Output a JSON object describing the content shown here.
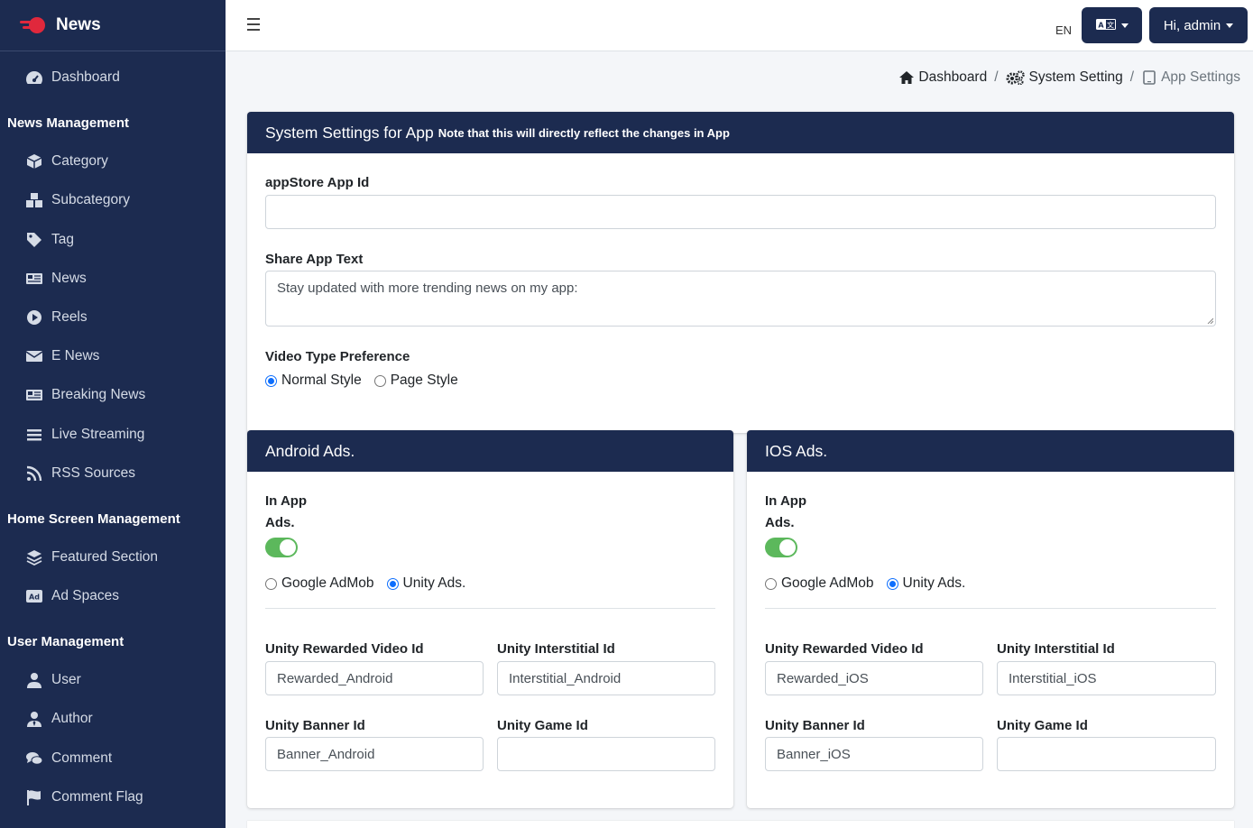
{
  "brand": {
    "name": "News"
  },
  "sidebar": {
    "dashboard": "Dashboard",
    "news_management_header": "News Management",
    "news_items": [
      "Category",
      "Subcategory",
      "Tag",
      "News",
      "Reels",
      "E News",
      "Breaking News",
      "Live Streaming",
      "RSS Sources"
    ],
    "home_screen_header": "Home Screen Management",
    "home_items": [
      "Featured Section",
      "Ad Spaces"
    ],
    "user_management_header": "User Management",
    "user_items": [
      "User",
      "Author",
      "Comment",
      "Comment Flag"
    ]
  },
  "topbar": {
    "lang_code": "EN",
    "user_greeting": "Hi, admin"
  },
  "breadcrumb": {
    "items": [
      "Dashboard",
      "System Setting",
      "App Settings"
    ],
    "separator": "/"
  },
  "system_card": {
    "title": "System Settings for App",
    "note": "Note that this will directly reflect the changes in App",
    "appstore_label": "appStore App Id",
    "appstore_value": "",
    "share_label": "Share App Text",
    "share_value": "Stay updated with more trending news on my app:",
    "video_pref_label": "Video Type Preference",
    "video_options": [
      "Normal Style",
      "Page Style"
    ],
    "video_selected": "Normal Style"
  },
  "android_card": {
    "title": "Android Ads.",
    "in_app_label_1": "In App",
    "in_app_label_2": "Ads.",
    "in_app_enabled": true,
    "provider_options": [
      "Google AdMob",
      "Unity Ads."
    ],
    "provider_selected": "Unity Ads.",
    "rewarded_label": "Unity Rewarded Video Id",
    "rewarded_value": "Rewarded_Android",
    "interstitial_label": "Unity Interstitial Id",
    "interstitial_value": "Interstitial_Android",
    "banner_label": "Unity Banner Id",
    "banner_value": "Banner_Android",
    "game_label": "Unity Game Id",
    "game_value": ""
  },
  "ios_card": {
    "title": "IOS Ads.",
    "in_app_label_1": "In App",
    "in_app_label_2": "Ads.",
    "in_app_enabled": true,
    "provider_options": [
      "Google AdMob",
      "Unity Ads."
    ],
    "provider_selected": "Unity Ads.",
    "rewarded_label": "Unity Rewarded Video Id",
    "rewarded_value": "Rewarded_iOS",
    "interstitial_label": "Unity Interstitial Id",
    "interstitial_value": "Interstitial_iOS",
    "banner_label": "Unity Banner Id",
    "banner_value": "Banner_iOS",
    "game_label": "Unity Game Id",
    "game_value": ""
  },
  "colors": {
    "sidebar_bg": "#1c2b50",
    "accent_blue": "#0d6efd",
    "toggle_on": "#5cb85c"
  },
  "icons": {
    "brand": "news-logo-icon",
    "dashboard": "tachometer-icon",
    "category": "cube-icon",
    "subcategory": "cubes-icon",
    "tag": "tag-icon",
    "news": "newspaper-icon",
    "reels": "play-circle-icon",
    "enews": "envelope-icon",
    "breaking": "newspaper-icon",
    "live": "list-icon",
    "rss": "rss-icon",
    "featured": "layer-group-icon",
    "adspaces": "ad-icon",
    "user": "user-icon",
    "author": "user-tie-icon",
    "comment": "comments-icon",
    "comment_flag": "flag-icon",
    "language": "language-icon",
    "home": "home-icon",
    "settings": "cogs-icon",
    "tablet": "tablet-icon"
  }
}
